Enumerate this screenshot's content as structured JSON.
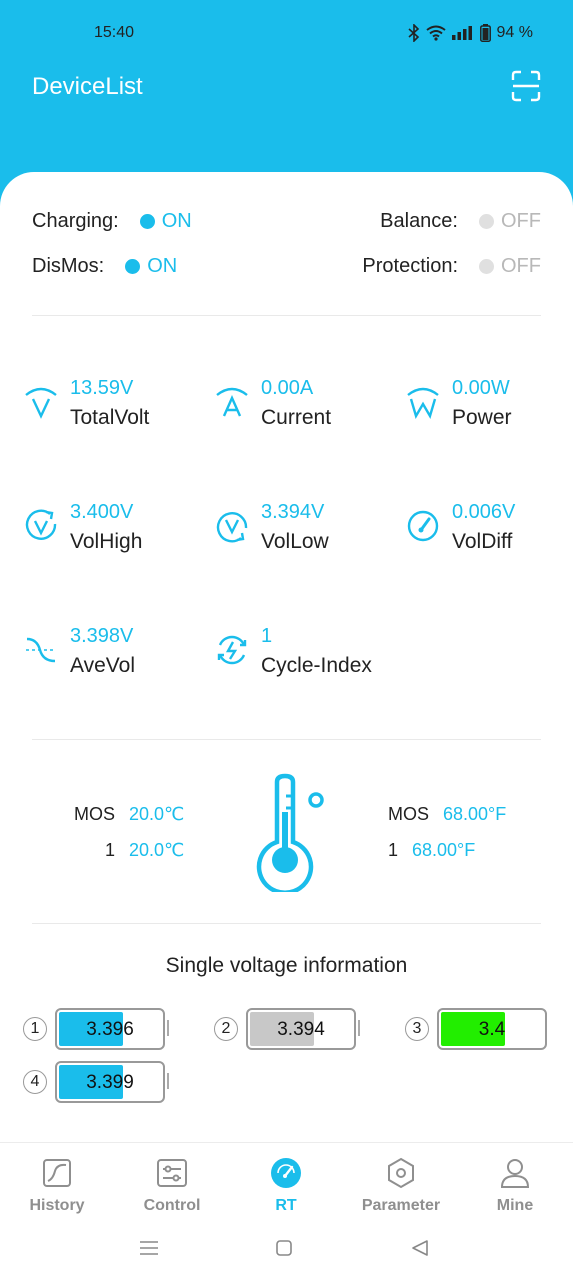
{
  "status_bar": {
    "time": "15:40",
    "battery": "94 %"
  },
  "header": {
    "title": "DeviceList",
    "scan_icon": "scan-icon"
  },
  "states": {
    "charging": {
      "label": "Charging:",
      "value": "ON"
    },
    "balance": {
      "label": "Balance:",
      "value": "OFF"
    },
    "dismos": {
      "label": "DisMos:",
      "value": "ON"
    },
    "protection": {
      "label": "Protection:",
      "value": "OFF"
    }
  },
  "metrics": [
    {
      "value": "13.59V",
      "label": "TotalVolt",
      "icon": "voltage-icon"
    },
    {
      "value": "0.00A",
      "label": "Current",
      "icon": "current-icon"
    },
    {
      "value": "0.00W",
      "label": "Power",
      "icon": "power-icon"
    },
    {
      "value": "3.400V",
      "label": "VolHigh",
      "icon": "voltage-high-icon"
    },
    {
      "value": "3.394V",
      "label": "VolLow",
      "icon": "voltage-low-icon"
    },
    {
      "value": "0.006V",
      "label": "VolDiff",
      "icon": "gauge-icon"
    },
    {
      "value": "3.398V",
      "label": "AveVol",
      "icon": "average-icon"
    },
    {
      "value": "1",
      "label": "Cycle-Index",
      "icon": "cycle-icon"
    }
  ],
  "temperatures": {
    "celsius": [
      {
        "key": "MOS",
        "value": "20.0℃"
      },
      {
        "key": "1",
        "value": "20.0℃"
      }
    ],
    "fahrenheit": [
      {
        "key": "MOS",
        "value": "68.00°F"
      },
      {
        "key": "1",
        "value": "68.00°F"
      }
    ]
  },
  "single_voltage": {
    "title": "Single voltage information",
    "cells": [
      {
        "index": "1",
        "value": "3.396",
        "fill_fraction": 0.6,
        "color": "#1ABDEB"
      },
      {
        "index": "2",
        "value": "3.394",
        "fill_fraction": 0.6,
        "color": "#C8C8C8"
      },
      {
        "index": "3",
        "value": "3.4",
        "fill_fraction": 0.6,
        "color": "#22EE00"
      },
      {
        "index": "4",
        "value": "3.399",
        "fill_fraction": 0.6,
        "color": "#1ABDEB"
      }
    ]
  },
  "tabs": [
    {
      "label": "History",
      "icon": "history-chart-icon"
    },
    {
      "label": "Control",
      "icon": "control-sliders-icon"
    },
    {
      "label": "RT",
      "icon": "realtime-gauge-icon",
      "active": true
    },
    {
      "label": "Parameter",
      "icon": "parameter-hex-icon"
    },
    {
      "label": "Mine",
      "icon": "user-icon"
    }
  ],
  "colors": {
    "accent": "#1ABDEB",
    "off": "#B8B8B8",
    "cell_green": "#22EE00"
  }
}
